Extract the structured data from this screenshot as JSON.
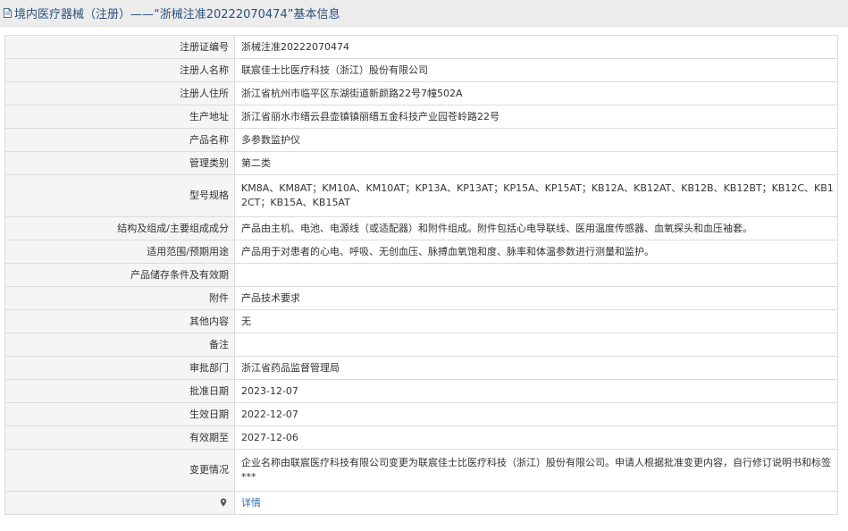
{
  "header": {
    "title": "境内医疗器械（注册）——“浙械注准20222070474”基本信息",
    "icon": "document-icon"
  },
  "rows": [
    {
      "key": "reg_no",
      "label": "注册证编号",
      "value": "浙械注准20222070474"
    },
    {
      "key": "registrant",
      "label": "注册人名称",
      "value": "联宸佳士比医疗科技（浙江）股份有限公司"
    },
    {
      "key": "registrant_addr",
      "label": "注册人住所",
      "value": "浙江省杭州市临平区东湖街道新颜路22号7幢502A"
    },
    {
      "key": "production_addr",
      "label": "生产地址",
      "value": "浙江省丽水市缙云县壶镇镇丽缙五金科技产业园苍岭路22号"
    },
    {
      "key": "product_name",
      "label": "产品名称",
      "value": "多参数监护仪"
    },
    {
      "key": "category",
      "label": "管理类别",
      "value": "第二类"
    },
    {
      "key": "models",
      "label": "型号规格",
      "value": "KM8A、KM8AT；KM10A、KM10AT；KP13A、KP13AT；KP15A、KP15AT；KB12A、KB12AT、KB12B、KB12BT；KB12C、KB12CT；KB15A、KB15AT"
    },
    {
      "key": "composition",
      "label": "结构及组成/主要组成成分",
      "value": "产品由主机、电池、电源线（或适配器）和附件组成。附件包括心电导联线、医用温度传感器、血氧探头和血压袖套。"
    },
    {
      "key": "intended_use",
      "label": "适用范围/预期用途",
      "value": "产品用于对患者的心电、呼吸、无创血压、脉搏血氧饱和度、脉率和体温参数进行测量和监护。"
    },
    {
      "key": "storage",
      "label": "产品储存条件及有效期",
      "value": ""
    },
    {
      "key": "attachment",
      "label": "附件",
      "value": "产品技术要求"
    },
    {
      "key": "other",
      "label": "其他内容",
      "value": "无"
    },
    {
      "key": "remark",
      "label": "备注",
      "value": ""
    },
    {
      "key": "approval_dept",
      "label": "审批部门",
      "value": "浙江省药品监督管理局"
    },
    {
      "key": "approval_date",
      "label": "批准日期",
      "value": "2023-12-07"
    },
    {
      "key": "effective_date",
      "label": "生效日期",
      "value": "2022-12-07"
    },
    {
      "key": "expiry_date",
      "label": "有效期至",
      "value": "2027-12-06"
    },
    {
      "key": "change",
      "label": "变更情况",
      "value": "企业名称由联宸医疗科技有限公司变更为联宸佳士比医疗科技（浙江）股份有限公司。申请人根据批准变更内容，自行修订说明书和标签***"
    }
  ],
  "detail_row": {
    "label_icon": "location-pin-icon",
    "link_text": "详情"
  },
  "colors": {
    "header_bg": "#ececec",
    "title_text": "#2c4f7c",
    "label_bg": "#f5f5f5",
    "border": "#dcdcdc",
    "link": "#2d6fb4"
  }
}
